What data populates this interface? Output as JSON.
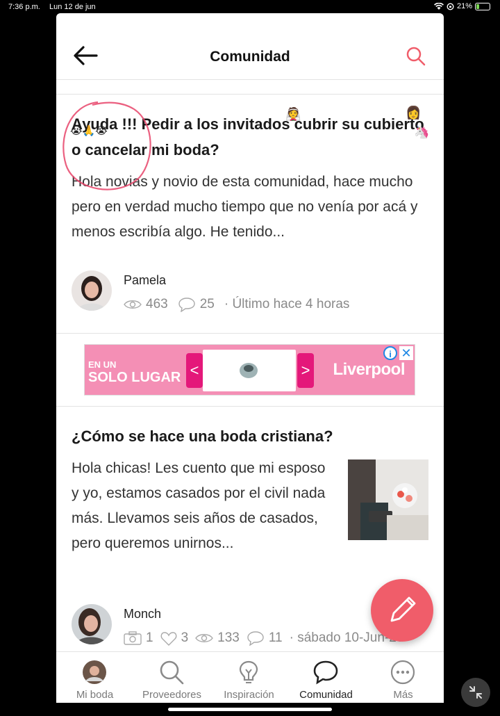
{
  "status_bar": {
    "time": "7:36 p.m.",
    "date": "Lun 12 de jun",
    "battery": "21%",
    "battery_level": 0.21
  },
  "header": {
    "title": "Comunidad"
  },
  "posts": [
    {
      "title": "Ayuda !!! Pedir a los invitados cubrir su cubierto o cancelar mi boda?",
      "body": "Hola novias y novio de esta comunidad, hace mucho pero en verdad mucho tiempo que no venía por acá y menos escribía algo. He tenido...",
      "author": "Pamela",
      "views": "463",
      "comments": "25",
      "last": "· Último hace 4 horas"
    },
    {
      "title": "¿Cómo se hace una boda cristiana?",
      "body": "Hola chicas! Les cuento que mi esposo y yo, estamos casados por el civil nada más. Llevamos seis años de casados, pero queremos unirnos...",
      "author": "Monch",
      "photos": "1",
      "likes": "3",
      "views": "133",
      "comments": "11",
      "last": "· sábado 10-Jun-23"
    }
  ],
  "ad": {
    "tag_top": "EN UN",
    "tag_main": "SOLO LUGAR",
    "brand": "Liverpool",
    "info": "i",
    "close": "✕",
    "prev": "<",
    "next": ">"
  },
  "bottom_nav": [
    {
      "label": "Mi boda",
      "icon": "avatar-icon",
      "active": false
    },
    {
      "label": "Proveedores",
      "icon": "search-icon",
      "active": false
    },
    {
      "label": "Inspiración",
      "icon": "lightbulb-icon",
      "active": false
    },
    {
      "label": "Comunidad",
      "icon": "chat-icon",
      "active": true
    },
    {
      "label": "Más",
      "icon": "more-icon",
      "active": false
    }
  ],
  "colors": {
    "accent": "#f05d6a",
    "ad_pink": "#f48fb5",
    "ad_magenta": "#e4187a"
  }
}
